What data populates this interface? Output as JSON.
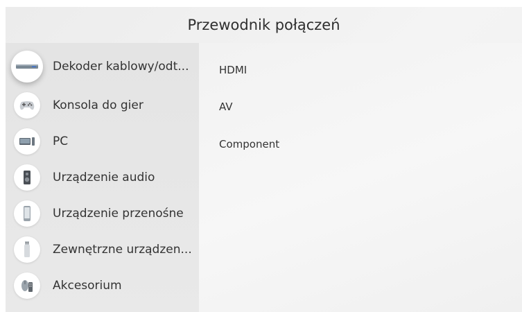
{
  "header": {
    "title": "Przewodnik połączeń"
  },
  "devices": [
    {
      "label": "Dekoder kablowy/odt...",
      "icon": "set-top-box-icon"
    },
    {
      "label": "Konsola do gier",
      "icon": "gamepad-icon"
    },
    {
      "label": "PC",
      "icon": "pc-icon"
    },
    {
      "label": "Urządzenie audio",
      "icon": "speaker-icon"
    },
    {
      "label": "Urządzenie przenośne",
      "icon": "phone-icon"
    },
    {
      "label": "Zewnętrzne urządzen...",
      "icon": "usb-drive-icon"
    },
    {
      "label": "Akcesorium",
      "icon": "mouse-keyboard-icon"
    }
  ],
  "connections": [
    {
      "label": "HDMI"
    },
    {
      "label": "AV"
    },
    {
      "label": "Component"
    }
  ],
  "colors": {
    "background": "#ececec",
    "left_column": "#e6e6e6",
    "text": "#333333",
    "icon_circle": "#ffffff"
  }
}
